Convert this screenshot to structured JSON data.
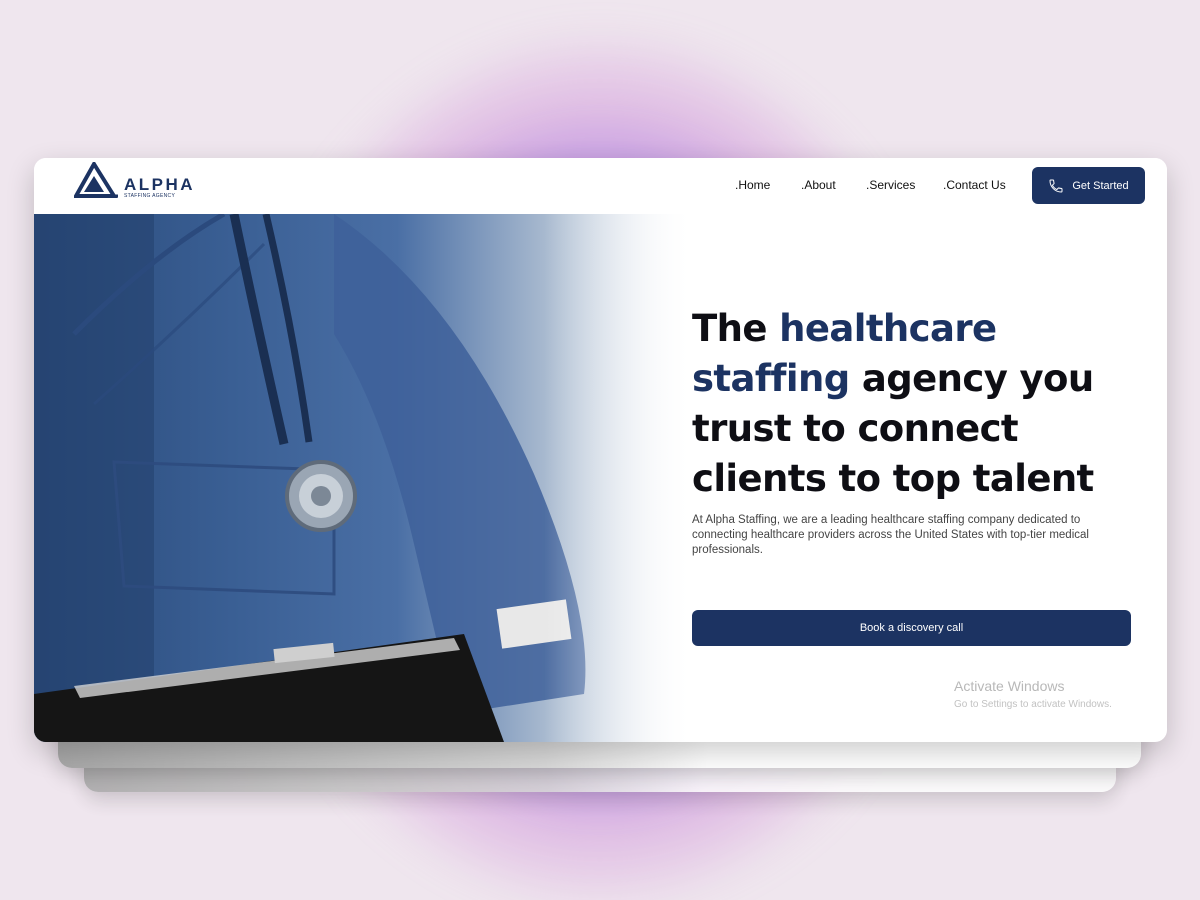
{
  "brand": {
    "name": "ALPHA",
    "tagline": "STAFFING AGENCY",
    "color": "#1c3362"
  },
  "nav": {
    "links": [
      {
        "label": ".Home"
      },
      {
        "label": ".About"
      },
      {
        "label": ".Services"
      },
      {
        "label": ".Contact Us"
      }
    ],
    "cta": {
      "label": "Get Started",
      "icon": "phone-icon"
    }
  },
  "hero": {
    "headline_lead": "The ",
    "headline_accent": "healthcare staffing",
    "headline_rest": " agency you trust to connect clients to top talent",
    "description": "At Alpha Staffing, we are a leading healthcare staffing company dedicated to connecting healthcare providers across the United States with top-tier medical professionals.",
    "button_label": "Book a discovery call",
    "image": "nurse-in-scrubs-with-stethoscope-and-clipboard"
  },
  "watermark": {
    "title": "Activate Windows",
    "subtitle": "Go to Settings to activate Windows."
  }
}
